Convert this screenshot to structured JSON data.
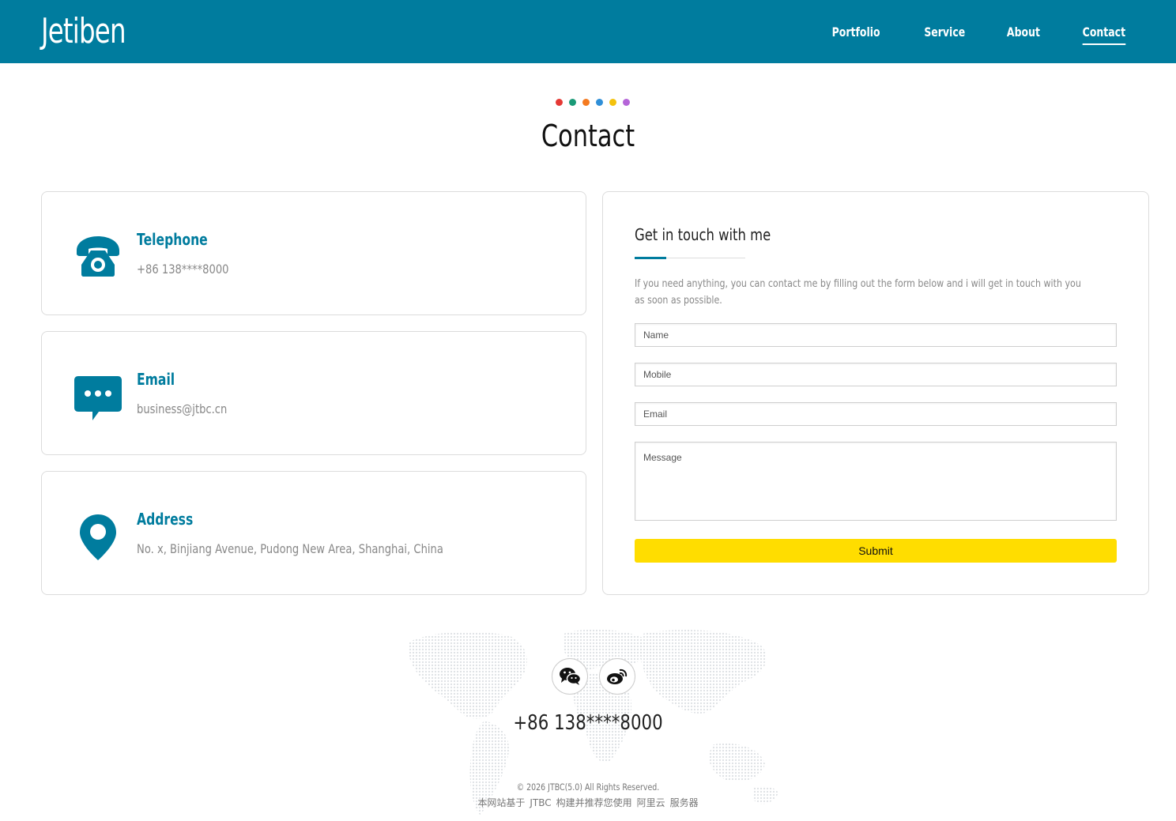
{
  "header": {
    "logo": "Jetiben",
    "nav": [
      {
        "label": "Portfolio",
        "active": false
      },
      {
        "label": "Service",
        "active": false
      },
      {
        "label": "About",
        "active": false
      },
      {
        "label": "Contact",
        "active": true
      }
    ],
    "bg_color": "#007c9e"
  },
  "hero": {
    "title": "Contact",
    "dot_colors": [
      "#e53935",
      "#1a9a77",
      "#f47a20",
      "#2f8fd8",
      "#f4c20d",
      "#b565d8"
    ]
  },
  "contact_cards": [
    {
      "icon": "telephone-icon",
      "title": "Telephone",
      "value": "+86 138****8000"
    },
    {
      "icon": "chat-bubble-icon",
      "title": "Email",
      "value": "business@jtbc.cn"
    },
    {
      "icon": "map-pin-icon",
      "title": "Address",
      "value": "No. x, Binjiang Avenue, Pudong New Area, Shanghai, China"
    }
  ],
  "form": {
    "title": "Get in touch with me",
    "description": "If you need anything, you can contact me by filling out the form below and i will get in touch with you as soon as possible.",
    "name_placeholder": "Name",
    "name_value": "",
    "mobile_placeholder": "Mobile",
    "mobile_value": "",
    "email_placeholder": "Email",
    "email_value": "",
    "message_placeholder": "Message",
    "message_value": "",
    "submit_label": "Submit",
    "submit_color": "#ffdd00"
  },
  "footer": {
    "social": [
      {
        "icon": "wechat-icon"
      },
      {
        "icon": "weibo-icon"
      }
    ],
    "phone": "+86 138****8000",
    "copyright": "© 2026 JTBC(5.0) All Rights Reserved.",
    "powered_prefix": "本网站基于",
    "powered_jtbc": "JTBC",
    "powered_middle": "构建并推荐您使用",
    "powered_aliyun": "阿里云",
    "powered_suffix": "服务器"
  }
}
